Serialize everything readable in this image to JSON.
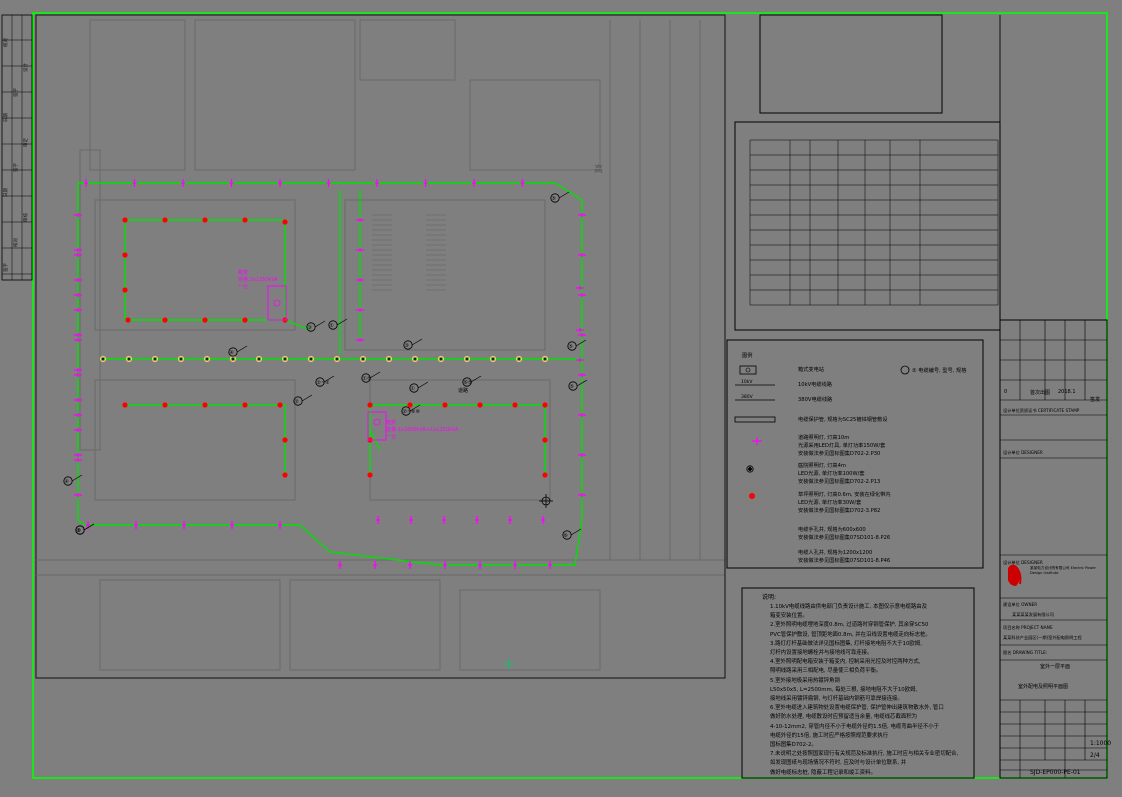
{
  "colors": {
    "background": "#7f7f7f",
    "border_green": "#00ff00",
    "road_green": "#00e000",
    "fixture_magenta": "#ff00ff",
    "fixture_red": "#ff0000",
    "cad_lines": "#6a6a6a",
    "text_black": "#000000"
  },
  "icons": {
    "street_light": "magenta-tick-icon",
    "courtyard_light": "diamond-circle-icon",
    "lawn_light": "red-dot-icon",
    "compass": "crosshair-icon"
  },
  "revision_strip": [
    "签字",
    "校对",
    "审核",
    "日期",
    "签字",
    "审定",
    "日期",
    "签字",
    "设计",
    "校对"
  ],
  "plan": {
    "callouts": [
      "⑤",
      "③",
      "①",
      "④",
      "③",
      "②~②",
      "①⑤",
      "②~⑥⑥",
      "⑤",
      "①",
      "②",
      "④",
      "⑤",
      "⑥⑤",
      "②",
      "⑥",
      "⑤"
    ],
    "box1_label": [
      "箱变",
      "容量:2x1250kVA",
      "一台"
    ],
    "box2_label": [
      "箱变",
      "容量:1x1600kVA+1x1250kVA",
      "一台"
    ],
    "road_label": "道路",
    "top_right_label": "高"
  },
  "legend": {
    "title": "图例",
    "rows": [
      {
        "symbol": "箱变",
        "desc": "箱式变电站"
      },
      {
        "symbol": "10kV",
        "desc": "10kV电缆线路"
      },
      {
        "symbol": "380V",
        "desc": "380V电缆线路"
      },
      {
        "symbol": "pipe",
        "desc": "电缆保护管, 规格为SC25镀锌钢管敷设"
      },
      {
        "symbol": "street",
        "desc": "道路照明灯, 灯高10m",
        "desc2": "光源采用LED灯具, 单灯功率150W/套",
        "desc3": "安装做法参见国标图集D702-2.P30"
      },
      {
        "symbol": "courtyard",
        "desc": "庭院照明灯, 灯高4m",
        "desc2": "LED光源, 单灯功率100W/套",
        "desc3": "安装做法参见国标图集D702-2.P13"
      },
      {
        "symbol": "lawn",
        "desc": "草坪照明灯, 灯高0.6m, 安装在绿化带内",
        "desc2": "LED光源, 单灯功率30W/套",
        "desc3": "安装做法参见国标图集D702-3.P82"
      },
      {
        "symbol": "",
        "desc": "电缆手孔井, 规格为600x600",
        "desc2": "安装做法参见国标图集07SD101-8.P26"
      },
      {
        "symbol": "",
        "desc": "电缆人孔井, 规格为1200x1200",
        "desc2": "安装做法参见国标图集07SD101-8.P46"
      }
    ],
    "marker_note": "⑤ 电缆编号, 型号, 规格"
  },
  "notes": {
    "title": "说明:",
    "lines": [
      "1.10kV电缆线路由供电部门负责设计施工, 本图仅示意电缆路由及",
      "  箱变安装位置。",
      "2.室外照明电缆埋地深度0.8m, 过道路时穿钢管保护, 其余穿SC50",
      "  PVC管保护敷设, 管顶距地面0.8m, 并在沿线设置电缆走向标志桩。",
      "3.路灯灯杆基础做法详见国标图集, 灯杆接地电阻不大于10欧姆,",
      "  灯杆内设置接地螺栓并与接地线可靠连接。",
      "4.室外照明配电箱安装于箱变内, 控制采用光控及时控两种方式,",
      "  照明线路采用三相配电, 尽量使三相负荷平衡。",
      "5.室外接地极采用热镀锌角钢",
      "  L50x50x5, L=2500mm, 每处三根, 接地电阻不大于10欧姆,",
      "  接地线采用镀锌扁钢, 与灯杆基础内钢筋可靠焊接连接。",
      "6.室外电缆进入建筑物处设置电缆保护管, 保护管伸出建筑物散水外, 管口",
      "  做好防水处理, 电缆敷设时应预留适当余量, 电缆线芯截面积为",
      "  4-10-12mm2, 穿管内径不小于电缆外径的1.5倍, 电缆弯曲半径不小于",
      "  电缆外径的15倍, 施工时应严格按照规范要求执行",
      "  国标图集D702-2。",
      "7.未说明之处按照国家现行有关规范及标准执行, 施工时应与相关专业密切配合,",
      "  如发现图纸与现场情况不符时, 应及时与设计单位联系, 并",
      "  做好电缆标志桩, 隐蔽工程记录和竣工资料。"
    ]
  },
  "titleblock": {
    "revision": {
      "no": "0",
      "desc": "首次出图",
      "date": "2018.1",
      "by": "签发"
    },
    "stamp_label": "设计单位资质证书 CERTIFICATE STAMP",
    "company_label": "设计单位 DESIGNER",
    "company_desc": "某某电力设计院有限公司 Electric Power Design Institute",
    "client_label": "建设单位 OWNER",
    "client_name": "某某某某发展有限公司",
    "project_label": "项目名称 PROJECT NAME",
    "project_name": "某某科技产业园区(一期)室外配电照明工程",
    "drawing_title_label": "图名 DRAWING TITLE:",
    "drawing_title": "室外一层平面",
    "drawing_subtitle": "室外配电及照明平面图",
    "scale": "1:1000",
    "sheet": "2/4",
    "drawing_number": "SJD-EP000-PE-01"
  }
}
